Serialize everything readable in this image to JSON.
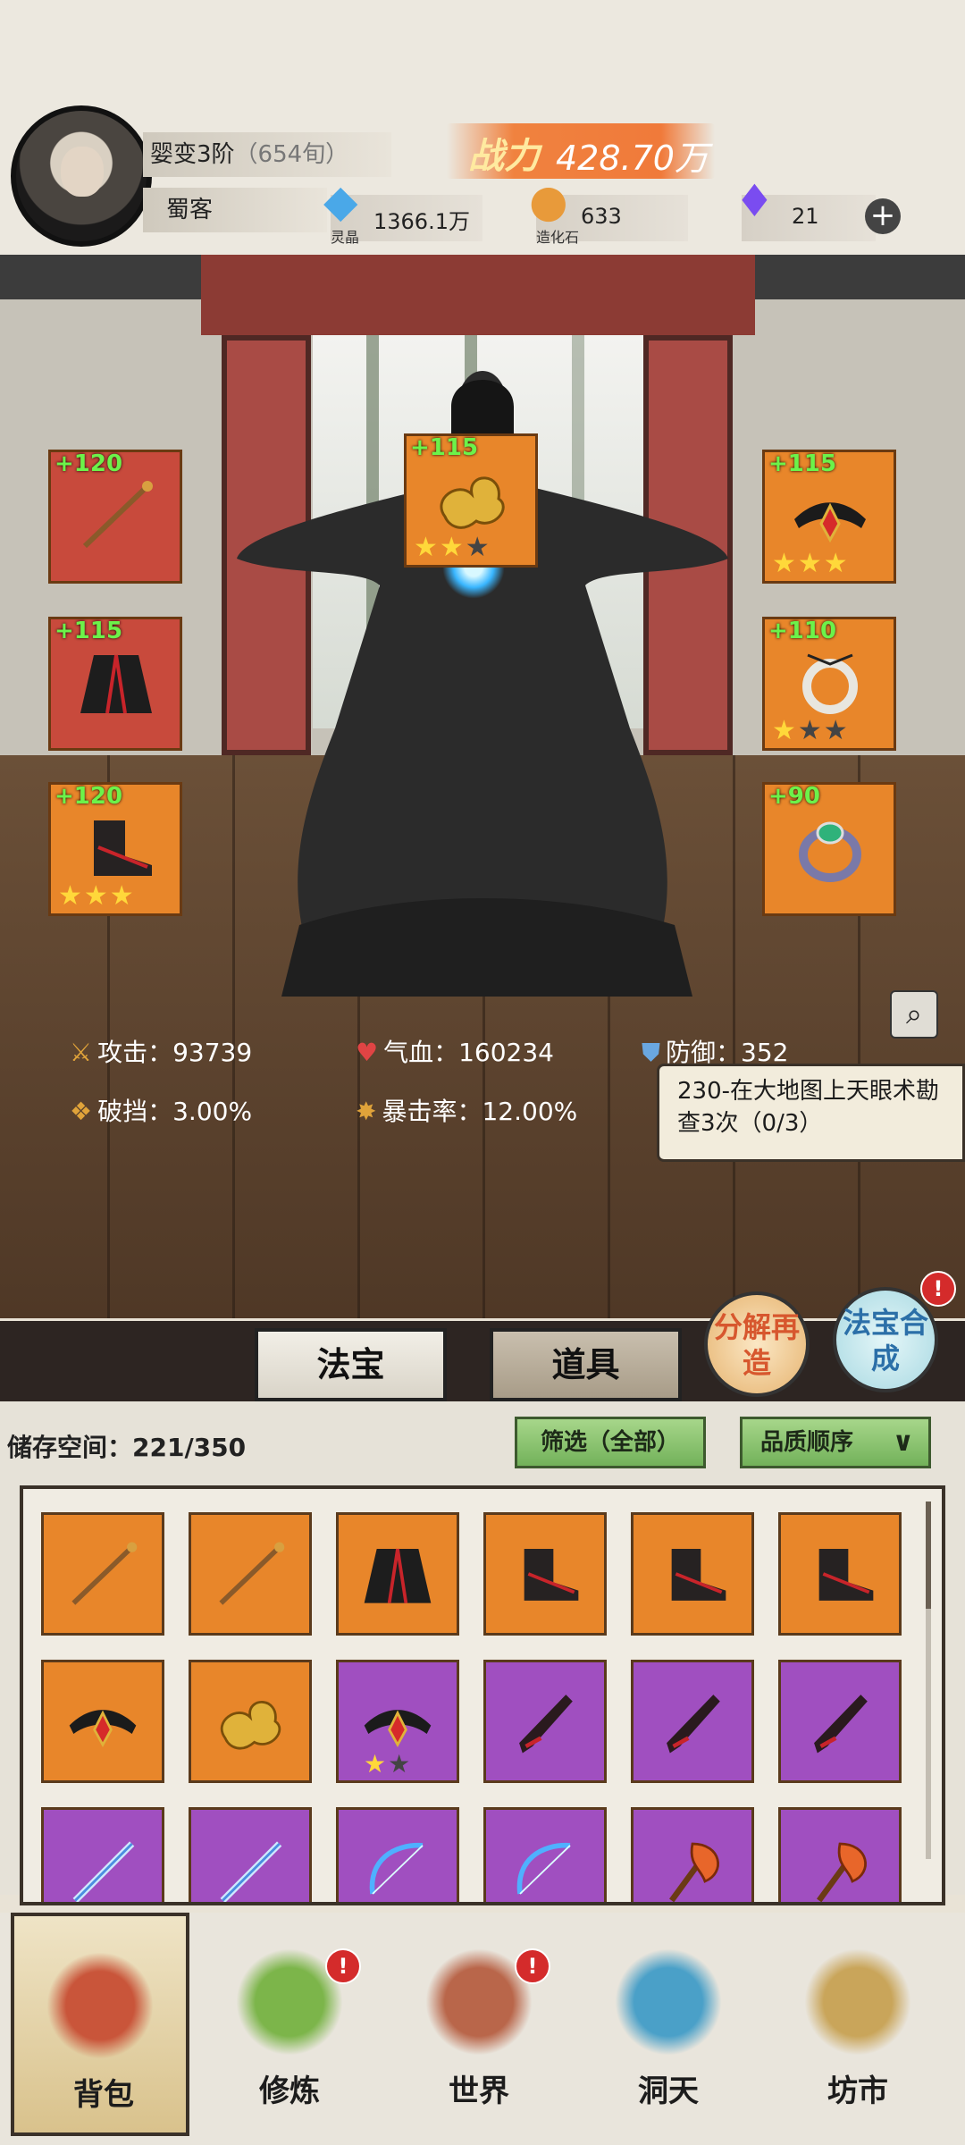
{
  "player": {
    "realm": "婴变3阶",
    "realm_sub": "（654旬）",
    "title": "蜀客"
  },
  "power": {
    "label": "战力",
    "value": "428.70万"
  },
  "resources": [
    {
      "icon": "spirit-crystal-icon",
      "value": "1366.1万",
      "caption": "灵晶"
    },
    {
      "icon": "creation-stone-icon",
      "value": "633",
      "caption": "造化石"
    },
    {
      "icon": "purple-flame-icon",
      "value": "21",
      "caption": ""
    }
  ],
  "equip_slots": [
    {
      "pos": "left-1",
      "level": "+120",
      "item": "staff",
      "stars": 0,
      "bg": "red"
    },
    {
      "pos": "left-2",
      "level": "+115",
      "item": "robe",
      "stars": 0,
      "bg": "red"
    },
    {
      "pos": "left-3",
      "level": "+120",
      "item": "boots",
      "stars": 3,
      "bg": "orange"
    },
    {
      "pos": "center",
      "level": "+115",
      "item": "golden-cloud-talisman",
      "stars": 2,
      "bg": "orange"
    },
    {
      "pos": "right-1",
      "level": "+115",
      "item": "crown",
      "stars": 3,
      "bg": "orange"
    },
    {
      "pos": "right-2",
      "level": "+110",
      "item": "jade-pendant",
      "stars": 1,
      "bg": "orange"
    },
    {
      "pos": "right-3",
      "level": "+90",
      "item": "emerald-ring",
      "stars": 0,
      "bg": "orange"
    }
  ],
  "stats": {
    "attack": "攻击：93739",
    "hp": "气血：160234",
    "defense": "防御：352",
    "break": "破挡：3.00%",
    "crit": "暴击率：12.00%"
  },
  "quest": {
    "text": "230-在大地图上天眼术勘查3次（0/3）"
  },
  "tabs": {
    "fabao": "法宝",
    "daoju": "道具"
  },
  "actions": {
    "decompose": "分解再造",
    "synthesize": "法宝合成",
    "badge": "!"
  },
  "inventory": {
    "storage": "储存空间：221/350",
    "filter": "筛选（全部）",
    "sort": "品质顺序",
    "items": [
      {
        "item": "staff",
        "bg": "orange",
        "stars": 0
      },
      {
        "item": "staff",
        "bg": "orange",
        "stars": 0
      },
      {
        "item": "robe",
        "bg": "orange",
        "stars": 0
      },
      {
        "item": "boots",
        "bg": "orange",
        "stars": 0
      },
      {
        "item": "boots",
        "bg": "orange",
        "stars": 0
      },
      {
        "item": "boots",
        "bg": "orange",
        "stars": 0
      },
      {
        "item": "crown",
        "bg": "orange",
        "stars": 0
      },
      {
        "item": "golden-cloud-talisman",
        "bg": "orange",
        "stars": 0
      },
      {
        "item": "crown",
        "bg": "purple",
        "stars": 1
      },
      {
        "item": "dark-blade",
        "bg": "purple",
        "stars": 0
      },
      {
        "item": "dark-blade",
        "bg": "purple",
        "stars": 0
      },
      {
        "item": "dark-blade",
        "bg": "purple",
        "stars": 0
      },
      {
        "item": "ice-sword",
        "bg": "purple",
        "stars": 0
      },
      {
        "item": "ice-sword",
        "bg": "purple",
        "stars": 0
      },
      {
        "item": "bow",
        "bg": "purple",
        "stars": 0
      },
      {
        "item": "bow",
        "bg": "purple",
        "stars": 0
      },
      {
        "item": "fire-axe",
        "bg": "purple",
        "stars": 0
      },
      {
        "item": "fire-axe",
        "bg": "purple",
        "stars": 0
      }
    ]
  },
  "nav": [
    {
      "label": "背包",
      "icon": "bag-icon",
      "active": true,
      "badge": false
    },
    {
      "label": "修炼",
      "icon": "lotus-icon",
      "active": false,
      "badge": true
    },
    {
      "label": "世界",
      "icon": "scroll-map-icon",
      "active": false,
      "badge": true
    },
    {
      "label": "洞天",
      "icon": "portal-icon",
      "active": false,
      "badge": false
    },
    {
      "label": "坊市",
      "icon": "market-chest-icon",
      "active": false,
      "badge": false
    }
  ],
  "colors": {
    "orange_slot": "#e8862a",
    "purple_slot": "#a04fc0",
    "red_slot": "#c84a3c",
    "level_green": "#6cf24a",
    "star_gold": "#ffd83a"
  }
}
